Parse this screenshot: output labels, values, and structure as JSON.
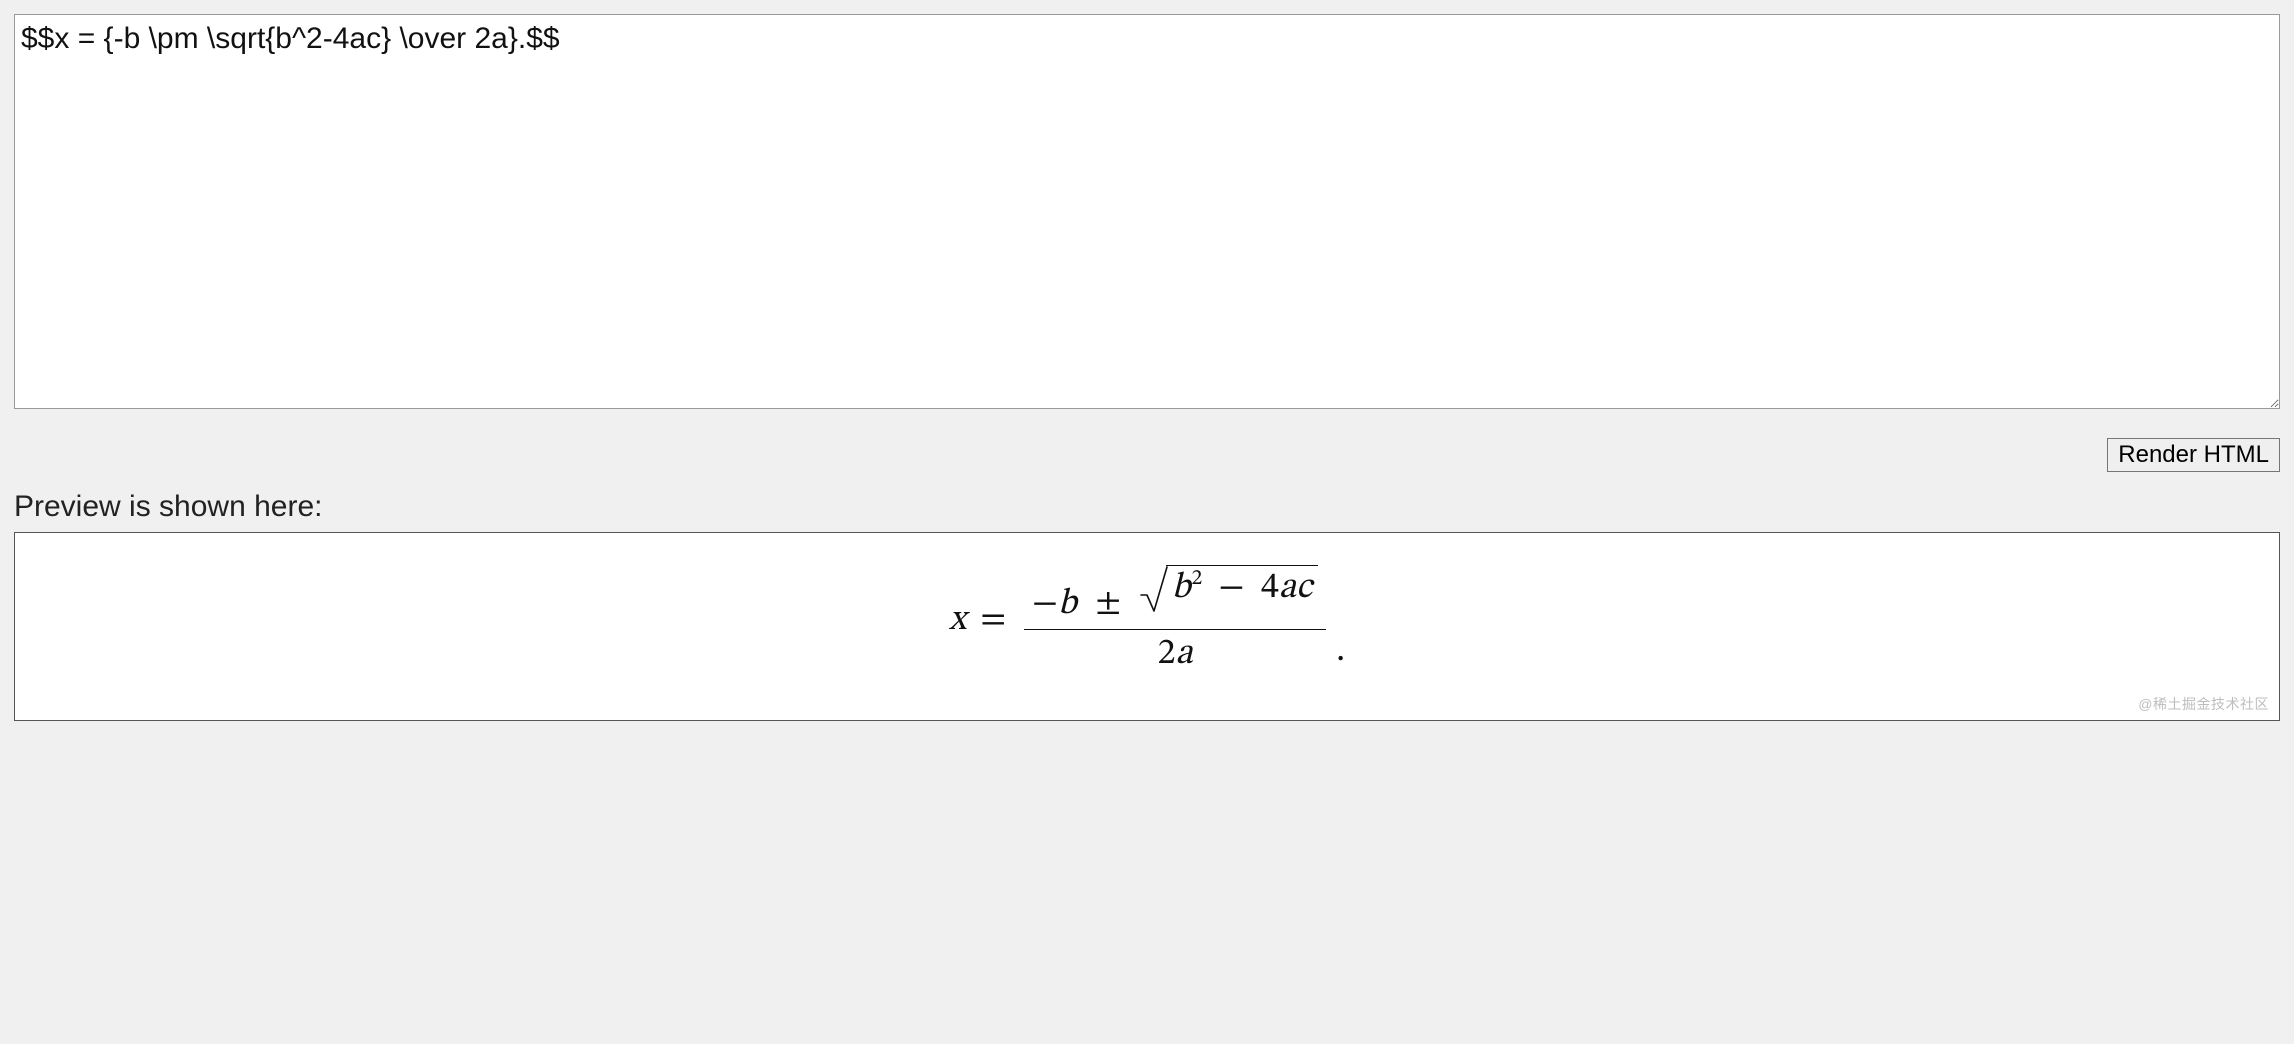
{
  "editor": {
    "value": "$$x = {-b \\pm \\sqrt{b^2-4ac} \\over 2a}.$$"
  },
  "toolbar": {
    "render_label": "Render HTML"
  },
  "preview": {
    "label": "Preview is shown here:",
    "equation": {
      "lhs_var": "x",
      "eq": "=",
      "minus": "−",
      "b": "b",
      "pm": "±",
      "b2": "b",
      "sup2": "2",
      "minus2": "−",
      "four": "4",
      "a": "a",
      "c": "c",
      "two": "2",
      "a2": "a",
      "period": "."
    },
    "watermark": "@稀土掘金技术社区"
  }
}
